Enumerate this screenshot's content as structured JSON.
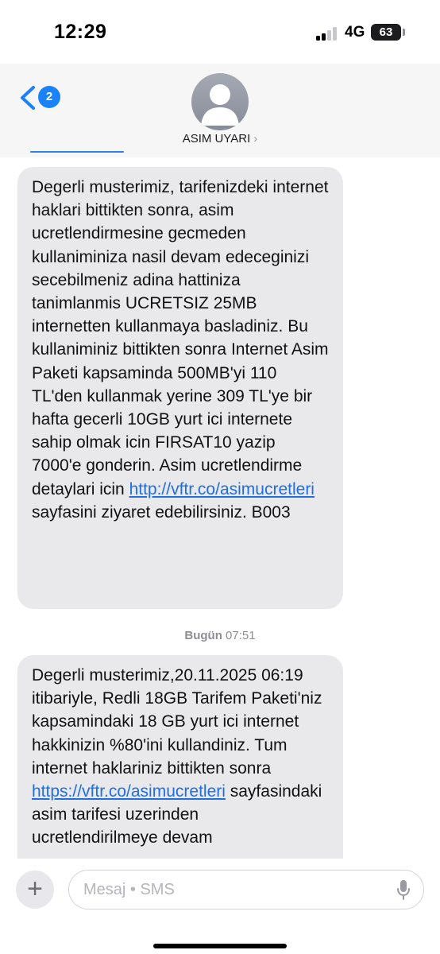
{
  "status_bar": {
    "time": "12:29",
    "network": "4G",
    "battery": "63"
  },
  "header": {
    "back_badge": "2",
    "contact_name": "ASIM UYARI",
    "chevron": "›"
  },
  "messages": [
    {
      "text_before": "Degerli musterimiz, tarifenizdeki internet haklari bittikten sonra, asim ucretlendirmesine gecmeden kullaniminiza nasil devam edeceginizi secebilmeniz adina hattiniza tanimlanmis UCRETSIZ 25MB internetten kullanmaya basladiniz. Bu kullaniminiz bittikten sonra Internet Asim Paketi kapsaminda 500MB'yi 110 TL'den kullanmak yerine 309 TL'ye bir hafta gecerli 10GB yurt ici internete sahip olmak icin FIRSAT10 yazip 7000'e gonderin. Asim ucretlendirme detaylari icin ",
      "link": "http://vftr.co/asimucretleri",
      "text_after": " sayfasini ziyaret edebilirsiniz. B003"
    },
    {
      "text_before": "Degerli musterimiz,20.11.2025 06:19 itibariyle, Redli 18GB Tarifem Paketi'niz kapsamindaki 18 GB yurt ici internet hakkinizin %80'ini kullandiniz. Tum internet haklariniz bittikten sonra ",
      "link": "https://vftr.co/asimucretleri",
      "text_after": " sayfasindaki asim tarifesi uzerinden ucretlendirilmeye devam"
    }
  ],
  "timestamp": {
    "day": "Bugün",
    "time": "07:51"
  },
  "input": {
    "plus_label": "+",
    "placeholder": "Mesaj • SMS"
  },
  "colors": {
    "accent": "#1a82fb",
    "bubble": "#e9e9eb",
    "link": "#1f6fe0"
  }
}
